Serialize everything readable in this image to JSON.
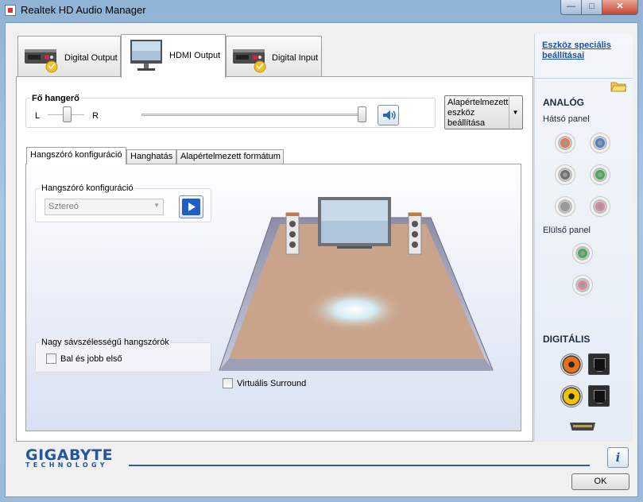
{
  "window": {
    "title": "Realtek HD Audio Manager",
    "controls": {
      "minimize": "—",
      "maximize": "□",
      "close": "✕"
    }
  },
  "device_tabs": [
    {
      "label": "Digital Output",
      "icon": "digital-output-device-icon",
      "active": false
    },
    {
      "label": "HDMI Output",
      "icon": "monitor-icon",
      "active": true
    },
    {
      "label": "Digital Input",
      "icon": "digital-input-device-icon",
      "active": false
    }
  ],
  "master_volume": {
    "title": "Fő hangerő",
    "left_label": "L",
    "right_label": "R",
    "balance": 0.5,
    "volume": 1.0,
    "mute_icon": "speaker-icon"
  },
  "default_device": {
    "label": "Alapértelmezett eszköz beállítása",
    "arrow": "▼"
  },
  "sub_tabs": [
    {
      "label": "Hangszóró konfiguráció",
      "active": true
    },
    {
      "label": "Hanghatás",
      "active": false
    },
    {
      "label": "Alapértelmezett formátum",
      "active": false
    }
  ],
  "speaker_config": {
    "group_title": "Hangszóró konfiguráció",
    "selected": "Sztereó",
    "play_icon": "play-icon"
  },
  "fullrange": {
    "group_title": "Nagy sávszélességű hangszórók",
    "checkbox_label": "Bal és jobb első",
    "checked": false
  },
  "virtual_surround": {
    "label": "Virtuális Surround",
    "checked": false
  },
  "right_panel": {
    "advanced_link": "Eszköz speciális beállításai",
    "analog_title": "ANALÓG",
    "rear_panel_title": "Hátsó panel",
    "front_panel_title": "Elülső panel",
    "digital_title": "DIGITÁLIS",
    "rear_jacks": [
      "#e07a4f",
      "#4f7fd0",
      "#707070",
      "#3fae55",
      "#9a9a9a",
      "#d98aa0"
    ],
    "front_jacks": [
      "#3fae55",
      "#d98aa0"
    ],
    "digital_ports": [
      {
        "type": "coaxial",
        "color": "#e8701a"
      },
      {
        "type": "optical"
      },
      {
        "type": "coaxial",
        "color": "#f2c200"
      },
      {
        "type": "optical"
      },
      {
        "type": "hdmi"
      }
    ]
  },
  "footer": {
    "brand": "GIGABYTE",
    "brand_sub": "TECHNOLOGY",
    "info_label": "i",
    "ok_label": "OK"
  }
}
